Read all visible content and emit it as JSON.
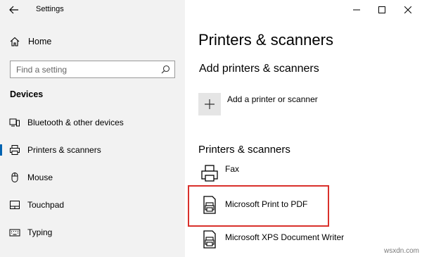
{
  "window": {
    "title": "Settings",
    "controls": {
      "minimize": "minimize",
      "maximize": "maximize",
      "close": "close"
    }
  },
  "sidebar": {
    "home_label": "Home",
    "search_placeholder": "Find a setting",
    "section_heading": "Devices",
    "items": [
      {
        "label": "Bluetooth & other devices",
        "icon": "bluetooth-devices-icon",
        "selected": false
      },
      {
        "label": "Printers & scanners",
        "icon": "printer-icon",
        "selected": true
      },
      {
        "label": "Mouse",
        "icon": "mouse-icon",
        "selected": false
      },
      {
        "label": "Touchpad",
        "icon": "touchpad-icon",
        "selected": false
      },
      {
        "label": "Typing",
        "icon": "keyboard-icon",
        "selected": false
      }
    ]
  },
  "main": {
    "page_title": "Printers & scanners",
    "add_section_heading": "Add printers & scanners",
    "add_button_label": "Add a printer or scanner",
    "list_heading": "Printers & scanners",
    "printers": [
      {
        "label": "Fax",
        "icon": "fax-icon"
      },
      {
        "label": "Microsoft Print to PDF",
        "icon": "pdf-printer-icon",
        "highlighted": true
      },
      {
        "label": "Microsoft XPS Document Writer",
        "icon": "xps-printer-icon"
      }
    ]
  },
  "watermark": "wsxdn.com",
  "colors": {
    "accent": "#0063b1",
    "highlight": "#d9302b",
    "sidebar_bg": "#f2f2f2"
  }
}
